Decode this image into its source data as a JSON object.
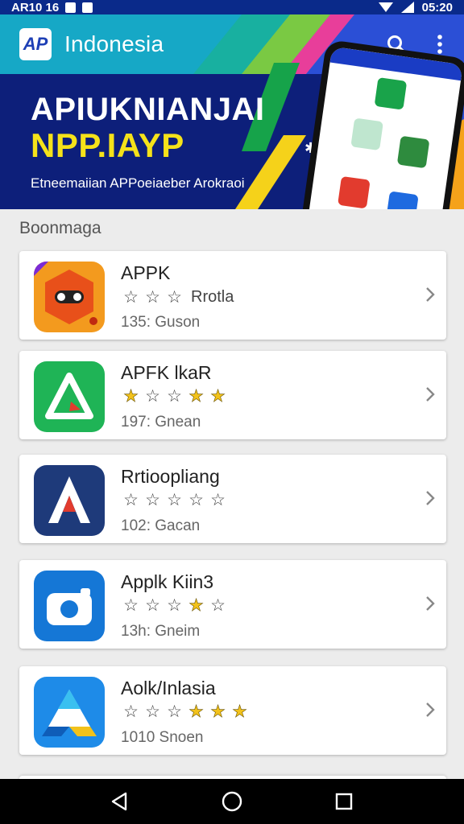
{
  "status_bar": {
    "left_text": "AR10 16",
    "time": "05:20"
  },
  "header": {
    "title": "Indonesia",
    "logo_text": "AP",
    "brand_color": "#0d1f7a"
  },
  "banner": {
    "title": "APIUKNIANJAI",
    "subtitle": "NPP.IAYP",
    "tagline": "Etneemaiian APPoeiaeber Arokraoi"
  },
  "section": {
    "title": "Boonmaga"
  },
  "apps": [
    {
      "name": "APPK",
      "stars": [
        0,
        0,
        0
      ],
      "rating_label": "Rrotla",
      "meta": "135: Guson",
      "icon": "owl-app-icon"
    },
    {
      "name": "APFK lkaR",
      "stars": [
        1,
        0,
        0,
        1,
        1
      ],
      "rating_label": "",
      "meta": "197: Gnean",
      "icon": "play-triangle-app-icon"
    },
    {
      "name": "Rrtioopliang",
      "stars": [
        0,
        0,
        0,
        0,
        0
      ],
      "rating_label": "",
      "meta": "102: Gacan",
      "icon": "letter-a-app-icon"
    },
    {
      "name": "Applk Kiin3",
      "stars": [
        0,
        0,
        0,
        1,
        0
      ],
      "rating_label": "",
      "meta": "13h: Gneim",
      "icon": "camera-app-icon"
    },
    {
      "name": "Aolk/Inlasia",
      "stars": [
        0,
        0,
        0,
        1,
        1,
        1
      ],
      "rating_label": "",
      "meta": "1010 Snoen",
      "icon": "drive-triangle-app-icon"
    }
  ],
  "icons": {
    "search": "search-icon",
    "more": "more-vert-icon",
    "back": "back-icon",
    "home": "home-icon",
    "recents": "recents-icon"
  }
}
